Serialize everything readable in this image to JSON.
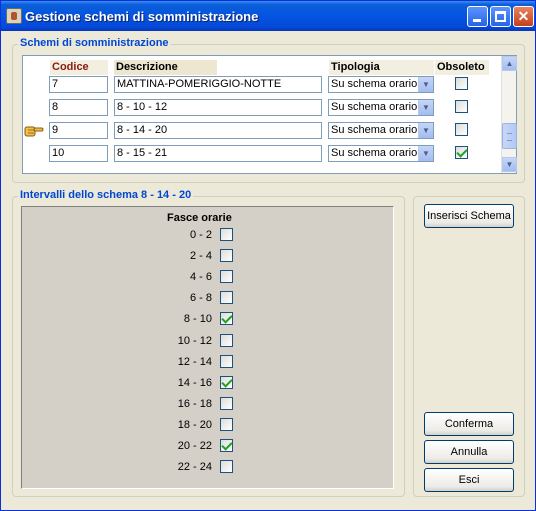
{
  "window": {
    "title": "Gestione schemi di somministrazione",
    "minimize_glyph": "",
    "maximize_glyph": "",
    "close_glyph": "✕"
  },
  "schemi": {
    "group_label": "Schemi di somministrazione",
    "headers": {
      "codice": "Codice",
      "descrizione": "Descrizione",
      "tipologia": "Tipologia",
      "obsoleto": "Obsoleto"
    },
    "rows": [
      {
        "codice": "7",
        "descrizione": "MATTINA-POMERIGGIO-NOTTE",
        "tipologia": "Su schema orario",
        "obsoleto": false,
        "current": false
      },
      {
        "codice": "8",
        "descrizione": "8 - 10 - 12",
        "tipologia": "Su schema orario",
        "obsoleto": false,
        "current": false
      },
      {
        "codice": "9",
        "descrizione": "8 - 14 - 20",
        "tipologia": "Su schema orario",
        "obsoleto": false,
        "current": true
      },
      {
        "codice": "10",
        "descrizione": "8 - 15 - 21",
        "tipologia": "Su schema orario",
        "obsoleto": true,
        "current": false
      }
    ],
    "scroll_up_glyph": "▲",
    "scroll_down_glyph": "▼",
    "combo_arrow_glyph": "▼"
  },
  "intervalli": {
    "group_label": "Intervalli dello schema 8 - 14 - 20",
    "fasce_title": "Fasce orarie",
    "slots": [
      {
        "label": "0 - 2",
        "checked": false
      },
      {
        "label": "2 - 4",
        "checked": false
      },
      {
        "label": "4 - 6",
        "checked": false
      },
      {
        "label": "6 - 8",
        "checked": false
      },
      {
        "label": "8 - 10",
        "checked": true
      },
      {
        "label": "10 - 12",
        "checked": false
      },
      {
        "label": "12 - 14",
        "checked": false
      },
      {
        "label": "14 - 16",
        "checked": true
      },
      {
        "label": "16 - 18",
        "checked": false
      },
      {
        "label": "18 - 20",
        "checked": false
      },
      {
        "label": "20 - 22",
        "checked": true
      },
      {
        "label": "22 - 24",
        "checked": false
      }
    ]
  },
  "buttons": {
    "inserisci": "Inserisci Schema",
    "conferma": "Conferma",
    "annulla": "Annulla",
    "esci": "Esci"
  },
  "colors": {
    "titlebar": "#0554e3",
    "group_label": "#0046d5",
    "codice_header": "#8b1a10",
    "check_mark": "#21a121"
  }
}
